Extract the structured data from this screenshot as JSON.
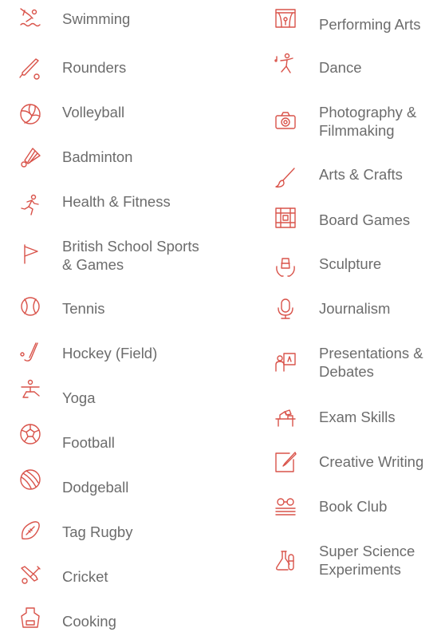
{
  "accent_color": "#d9534a",
  "left_column": [
    {
      "label": "Swimming",
      "icon": "swimming-icon"
    },
    {
      "label": "Rounders",
      "icon": "rounders-bat-icon"
    },
    {
      "label": "Volleyball",
      "icon": "volleyball-icon"
    },
    {
      "label": "Badminton",
      "icon": "shuttlecock-icon"
    },
    {
      "label": "Health & Fitness",
      "icon": "running-person-icon"
    },
    {
      "label_line1": "British School Sports",
      "label_line2": "& Games",
      "icon": "flag-icon"
    },
    {
      "label": "Tennis",
      "icon": "tennis-ball-icon"
    },
    {
      "label": "Hockey (Field)",
      "icon": "hockey-stick-icon"
    },
    {
      "label": "Yoga",
      "icon": "yoga-pose-icon"
    },
    {
      "label": "Football",
      "icon": "football-icon"
    },
    {
      "label": "Dodgeball",
      "icon": "dodgeball-icon"
    },
    {
      "label": "Tag Rugby",
      "icon": "rugby-ball-icon"
    },
    {
      "label": "Cricket",
      "icon": "cricket-bats-icon"
    },
    {
      "label": "Cooking",
      "icon": "apron-icon"
    }
  ],
  "right_column": [
    {
      "label": "Performing Arts",
      "icon": "stage-icon"
    },
    {
      "label": "Dance",
      "icon": "dancer-icon"
    },
    {
      "label_line1": "Photography &",
      "label_line2": "Filmmaking",
      "icon": "camera-icon"
    },
    {
      "label": "Arts & Crafts",
      "icon": "paintbrush-icon"
    },
    {
      "label": "Board Games",
      "icon": "board-game-icon"
    },
    {
      "label": "Sculpture",
      "icon": "sculpture-hands-icon"
    },
    {
      "label": "Journalism",
      "icon": "microphone-icon"
    },
    {
      "label_line1": "Presentations &",
      "label_line2": "Debates",
      "icon": "presenter-icon"
    },
    {
      "label": "Exam Skills",
      "icon": "desk-lamp-icon"
    },
    {
      "label": "Creative Writing",
      "icon": "pen-and-paper-icon"
    },
    {
      "label": "Book Club",
      "icon": "books-glasses-icon"
    },
    {
      "label_line1": "Super Science",
      "label_line2": "Experiments",
      "icon": "flask-icon"
    }
  ]
}
